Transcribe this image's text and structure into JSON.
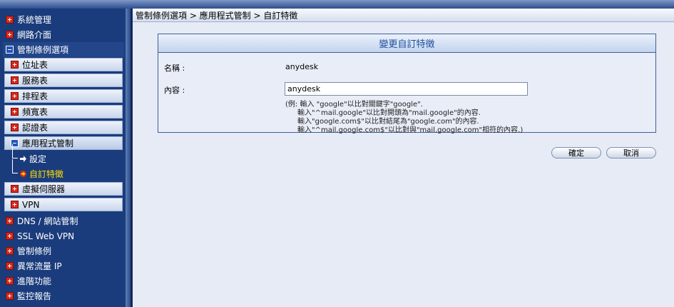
{
  "breadcrumb": "管制條例選項 > 應用程式管制 > 自訂特徵",
  "sidebar": {
    "items": [
      {
        "label": "系統管理"
      },
      {
        "label": "網路介面"
      },
      {
        "label": "管制條例選項"
      },
      {
        "label": "位址表"
      },
      {
        "label": "服務表"
      },
      {
        "label": "排程表"
      },
      {
        "label": "頻寬表"
      },
      {
        "label": "認證表"
      },
      {
        "label": "應用程式管制"
      },
      {
        "label": "設定"
      },
      {
        "label": "自訂特徵"
      },
      {
        "label": "虛擬伺服器"
      },
      {
        "label": "VPN"
      },
      {
        "label": "DNS / 網站管制"
      },
      {
        "label": "SSL Web VPN"
      },
      {
        "label": "管制條例"
      },
      {
        "label": "異常流量 IP"
      },
      {
        "label": "進階功能"
      },
      {
        "label": "監控報告"
      }
    ]
  },
  "form": {
    "title": "變更自訂特徵",
    "name_label": "名稱 :",
    "name_value": "anydesk",
    "content_label": "內容 :",
    "content_value": "anydesk",
    "hints": [
      "(例: 輸入 \"google\"以比對關鍵字\"google\".",
      "輸入\"^mail.google\"以比對開頭為\"mail.google\"的內容.",
      "輸入\"google.com$\"以比對結尾為\"google.com\"的內容.",
      "輸入\"^mail.google.com$\"以比對與\"mail.google.com\"相符的內容.)"
    ]
  },
  "buttons": {
    "ok": "確定",
    "cancel": "取消"
  },
  "colors": {
    "sidebar_bg": "#1b3c7c",
    "active_leaf": "#ffe000",
    "panel_title_text": "#1e4d9a"
  }
}
